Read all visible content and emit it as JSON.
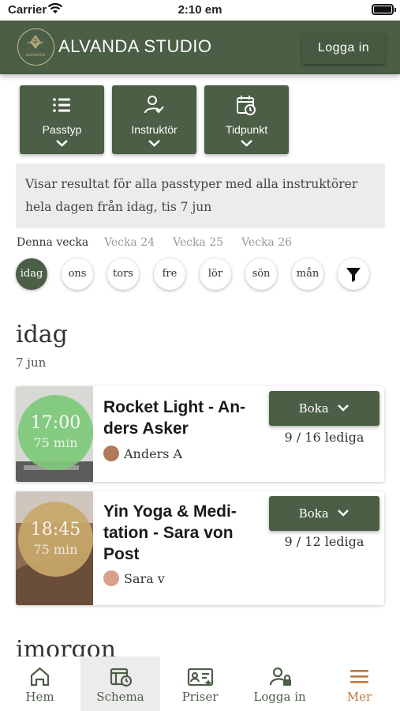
{
  "status_bar": {
    "carrier": "Carrier",
    "time": "2:10 em"
  },
  "header": {
    "brand": "ALVANDA STUDIO",
    "logo_text": "ALVANDA",
    "login_label": "Logga in"
  },
  "filters": [
    {
      "label": "Passtyp",
      "icon": "list-icon"
    },
    {
      "label": "Instruktör",
      "icon": "user-check-icon"
    },
    {
      "label": "Tidpunkt",
      "icon": "calendar-clock-icon"
    }
  ],
  "info_text": "Visar resultat för alla passtyper med alla instruktörer hela dagen från idag, tis 7 jun",
  "weeks": [
    "Denna vecka",
    "Vecka 24",
    "Vecka 25",
    "Vecka 26"
  ],
  "days": [
    "idag",
    "ons",
    "tors",
    "fre",
    "lör",
    "sön",
    "mån"
  ],
  "sections": [
    {
      "title": "idag",
      "subtitle": "7 jun"
    },
    {
      "title": "imorgon"
    }
  ],
  "classes": [
    {
      "time": "17:00",
      "duration": "75 min",
      "title": "Rocket Light - An-ders Asker",
      "instructor": "Anders A",
      "book_label": "Boka",
      "spots": "9 / 16 lediga"
    },
    {
      "time": "18:45",
      "duration": "75 min",
      "title": "Yin Yoga & Medi-tation - Sara von Post",
      "instructor": "Sara v",
      "book_label": "Boka",
      "spots": "9 / 12 lediga"
    }
  ],
  "tabs": [
    {
      "label": "Hem",
      "icon": "home-icon"
    },
    {
      "label": "Schema",
      "icon": "schedule-icon"
    },
    {
      "label": "Priser",
      "icon": "price-card-icon"
    },
    {
      "label": "Logga in",
      "icon": "user-lock-icon"
    },
    {
      "label": "Mer",
      "icon": "menu-icon"
    }
  ],
  "colors": {
    "primary": "#4b5e46",
    "accent": "#c2783d",
    "circle_green": "#7fc97a",
    "circle_gold": "#c9a86a"
  }
}
